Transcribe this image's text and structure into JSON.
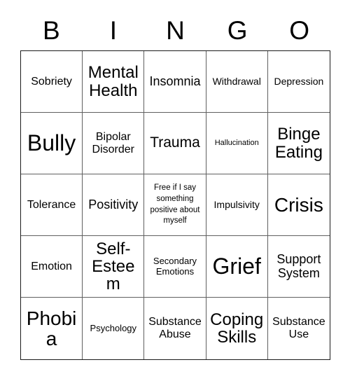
{
  "card": {
    "title": "Bingo Card",
    "header_letters": [
      "B",
      "I",
      "N",
      "G",
      "O"
    ],
    "columns": 5,
    "rows": 5,
    "border_color": "#1a1a1a",
    "grid_line_color": "#606060",
    "background_color": "#ffffff",
    "text_color": "#000000"
  },
  "squares": [
    {
      "text": "Sobriety",
      "size": "md",
      "row": 1,
      "col": 1,
      "free": false
    },
    {
      "text": "Mental Health",
      "size": "xl",
      "row": 1,
      "col": 2,
      "free": false
    },
    {
      "text": "Insomnia",
      "size": "mdl",
      "row": 1,
      "col": 3,
      "free": false
    },
    {
      "text": "Withdrawal",
      "size": "smm",
      "row": 1,
      "col": 4,
      "free": false
    },
    {
      "text": "Depression",
      "size": "smm",
      "row": 1,
      "col": 5,
      "free": false
    },
    {
      "text": "Bully",
      "size": "huge",
      "row": 2,
      "col": 1,
      "free": false
    },
    {
      "text": "Bipolar Disorder",
      "size": "md",
      "row": 2,
      "col": 2,
      "free": false
    },
    {
      "text": "Trauma",
      "size": "lg",
      "row": 2,
      "col": 3,
      "free": false
    },
    {
      "text": "Hallucination",
      "size": "xs",
      "row": 2,
      "col": 4,
      "free": false
    },
    {
      "text": "Binge Eating",
      "size": "xl",
      "row": 2,
      "col": 5,
      "free": false
    },
    {
      "text": "Tolerance",
      "size": "md",
      "row": 3,
      "col": 1,
      "free": false
    },
    {
      "text": "Positivity",
      "size": "mdl",
      "row": 3,
      "col": 2,
      "free": false
    },
    {
      "text": "Free if I say something positive about myself",
      "size": "free",
      "row": 3,
      "col": 3,
      "free": true
    },
    {
      "text": "Impulsivity",
      "size": "smm",
      "row": 3,
      "col": 4,
      "free": false
    },
    {
      "text": "Crisis",
      "size": "xxl",
      "row": 3,
      "col": 5,
      "free": false
    },
    {
      "text": "Emotion",
      "size": "md",
      "row": 4,
      "col": 1,
      "free": false
    },
    {
      "text": "Self-Esteem",
      "size": "xl",
      "row": 4,
      "col": 2,
      "free": false
    },
    {
      "text": "Secondary Emotions",
      "size": "sm",
      "row": 4,
      "col": 3,
      "free": false
    },
    {
      "text": "Grief",
      "size": "huge",
      "row": 4,
      "col": 4,
      "free": false
    },
    {
      "text": "Support System",
      "size": "mdl",
      "row": 4,
      "col": 5,
      "free": false
    },
    {
      "text": "Phobia",
      "size": "xxl",
      "row": 5,
      "col": 1,
      "free": false
    },
    {
      "text": "Psychology",
      "size": "sm",
      "row": 5,
      "col": 2,
      "free": false
    },
    {
      "text": "Substance Abuse",
      "size": "md",
      "row": 5,
      "col": 3,
      "free": false
    },
    {
      "text": "Coping Skills",
      "size": "xl",
      "row": 5,
      "col": 4,
      "free": false
    },
    {
      "text": "Substance Use",
      "size": "md",
      "row": 5,
      "col": 5,
      "free": false
    }
  ]
}
